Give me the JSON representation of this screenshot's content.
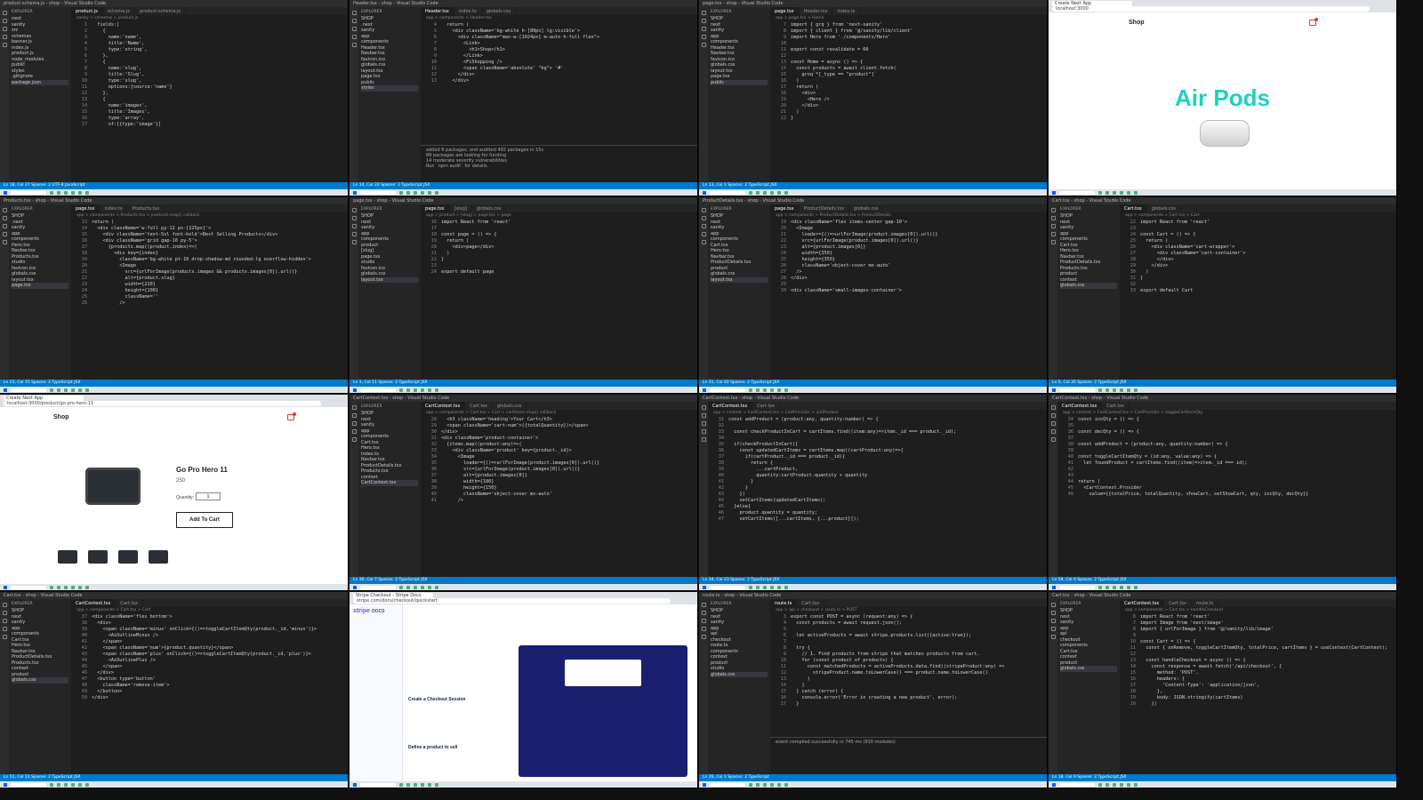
{
  "tiles": [
    {
      "kind": "editor",
      "title": "product-schema.js - shop - Visual Studio Code",
      "tabs": [
        "product.js",
        "schema.js",
        "product-schema.js"
      ],
      "breadcrumb": "sanity > schemas > product.js",
      "files": [
        "next",
        "sanity",
        "src",
        "schemas",
        "banner.js",
        "index.js",
        "product.js",
        "node_modules",
        "public",
        "styles",
        ".gitignore",
        "package.json"
      ],
      "code": [
        "  fields:[",
        "    {",
        "      name:'name',",
        "      title:'Name',",
        "      type:'string',",
        "    },",
        "    {",
        "      name:'slug',",
        "      title:'Slug',",
        "      type:'slug',",
        "      options:{source:'name'}",
        "    },",
        "    {",
        "      name:'images',",
        "      title:'Images',",
        "      type:'array',",
        "      of:[{type:'image'}]"
      ],
      "status": "Ln 18, Col 27  Spaces: 2  UTF-8  JavaScript"
    },
    {
      "kind": "editor",
      "title": "Header.tsx - shop - Visual Studio Code",
      "tabs": [
        "Header.tsx",
        "index.ts",
        "globals.css"
      ],
      "breadcrumb": "app > components > Header.tsx",
      "files": [
        "SHOP",
        ".next",
        "sanity",
        "app",
        "components",
        "Header.tsx",
        "Navbar.tsx",
        "favicon.ico",
        "globals.css",
        "layout.tsx",
        "page.tsx",
        "public",
        "styles"
      ],
      "code": [
        "  return (",
        "    <div className='bg-white h-[80px] lg:visible'>",
        "      <div className=\"max-w-[1024px] m-auto h-full flex\">",
        "        <Link>",
        "          <h1>Shop</h1>",
        "        </Link>",
        "        <FiShopping />",
        "        <span className='absolute' \"bg\"> '#'",
        "      </div>",
        "    </div>"
      ],
      "panel": [
        "added 8 packages, and audited 492 packages in 15s",
        "89 packages are looking for funding",
        "14 moderate severity vulnerabilities",
        "Run `npm audit` for details."
      ],
      "status": "Ln 14, Col 22  Spaces: 2  TypeScript JSX"
    },
    {
      "kind": "editor",
      "title": "page.tsx - shop - Visual Studio Code",
      "tabs": [
        "page.tsx",
        "Header.tsx",
        "index.ts"
      ],
      "breadcrumb": "app > page.tsx > Home",
      "files": [
        "SHOP",
        "next",
        "sanity",
        "app",
        "components",
        "Header.tsx",
        "Navbar.tsx",
        "favicon.ico",
        "globals.css",
        "layout.tsx",
        "page.tsx",
        "public"
      ],
      "code": [
        "import { grq } from 'next-sanity'",
        "import { client } from '@/sanity/lib/client'",
        "import Hero from './components/Hero'",
        "",
        "export const revalidate = 60",
        "",
        "const Home = async () => {",
        "  const products = await client.fetch(",
        "    groq`*[_type == \"product\"]`",
        "  )",
        "  return (",
        "    <div>",
        "      <Hero />",
        "    </div>",
        "  )",
        "}"
      ],
      "status": "Ln 13, Col 1  Spaces: 2  TypeScript JSX"
    },
    {
      "kind": "browser",
      "tab": "Create Next App",
      "url": "localhost:3000",
      "shop": "Shop",
      "headline": "Air Pods"
    },
    {
      "kind": "editor",
      "title": "Products.tsx - shop - Visual Studio Code",
      "tabs": [
        "page.tsx",
        "index.ts",
        "Products.tsx"
      ],
      "breadcrumb": "app > components > Products.tsx > products.map() callback",
      "files": [
        "SHOP",
        ".next",
        "sanity",
        "app",
        "components",
        "Hero.tsx",
        "Navbar.tsx",
        "Products.tsx",
        "studio",
        "favicon.ico",
        "globals.css",
        "layout.tsx",
        "page.tsx"
      ],
      "code": [
        "return (",
        "  <div className='w-full py-12 px-[125px]'>",
        "    <div className='text-5xl font-bold'>Best Selling Products</div>",
        "    <div className='grid gap-10 py-5'>",
        "      {products.map((product,index)=>(",
        "        <div key={index}",
        "          className='bg-white pt-10 drop-shadow-md rounded-lg overflow-hidden'>",
        "          <Image",
        "            src={urlForImage(products.images && products.images[0]).url()}",
        "            alt={product.slug}",
        "            width={220}",
        "            height={100}",
        "            className=''",
        "          />"
      ],
      "status": "Ln 23, Col 15  Spaces: 2  TypeScript JSX"
    },
    {
      "kind": "editor",
      "title": "page.tsx - shop - Visual Studio Code",
      "tabs": [
        "page.tsx",
        "[slug]",
        "globals.css"
      ],
      "breadcrumb": "app > product > [slug] > page.tsx > page",
      "files": [
        "SHOP",
        "next",
        "sanity",
        "app",
        "components",
        "product",
        "[slug]",
        "page.tsx",
        "studio",
        "favicon.ico",
        "globals.css",
        "layout.tsx"
      ],
      "code": [
        "import React from 'react'",
        "",
        "const page = () => {",
        "  return (",
        "    <div>page</div>",
        "  )",
        "}",
        "",
        "export default page"
      ],
      "status": "Ln 3, Col 11  Spaces: 2  TypeScript JSX"
    },
    {
      "kind": "editor",
      "title": "ProductDetails.tsx - shop - Visual Studio Code",
      "tabs": [
        "page.tsx",
        "ProductDetails.tsx",
        "globals.css"
      ],
      "breadcrumb": "app > components > ProductDetails.tsx > ProductDetails",
      "files": [
        "SHOP",
        "next",
        "sanity",
        "app",
        "components",
        "Cart.tsx",
        "Hero.tsx",
        "Navbar.tsx",
        "ProductDetails.tsx",
        "product",
        "globals.css",
        "layout.tsx"
      ],
      "code": [
        "<div className='flex items-center gap-10'>",
        "  <Image",
        "    loader={()=>urlForImage(product.images[0]).url()}",
        "    src={urlForImage(product.images[0]).url()}",
        "    alt={product.images[0]}",
        "    width={350}",
        "    height={350}",
        "    className='object-cover mx-auto'",
        "  />",
        "</div>",
        "",
        "<div className='small-images-container'>"
      ],
      "status": "Ln 31, Col 42  Spaces: 2  TypeScript JSX"
    },
    {
      "kind": "editor",
      "title": "Cart.tsx - shop - Visual Studio Code",
      "tabs": [
        "Cart.tsx",
        "globals.css"
      ],
      "breadcrumb": "app > components > Cart.tsx > Cart",
      "files": [
        "SHOP",
        "next",
        "sanity",
        "app",
        "components",
        "Cart.tsx",
        "Hero.tsx",
        "Navbar.tsx",
        "ProductDetails.tsx",
        "Products.tsx",
        "product",
        "context",
        "globals.css"
      ],
      "code": [
        "import React from 'react'",
        "",
        "const Cart = () => {",
        "  return (",
        "    <div className='cart-wrapper'>",
        "      <div className='cart-container'>",
        "      </div>",
        "    </div>",
        "  )",
        "}",
        "",
        "export default Cart"
      ],
      "status": "Ln 5, Col 35  Spaces: 2  TypeScript JSX"
    },
    {
      "kind": "product",
      "tab": "Create Next App",
      "url": "localhost:3000/product/go-pro-hero-11",
      "shop": "Shop",
      "name": "Go Pro Hero 11",
      "price": "250",
      "qty_label": "Quantity:",
      "qty": "1",
      "cta": "Add To Cart"
    },
    {
      "kind": "editor",
      "title": "CartContext.tsx - shop - Visual Studio Code",
      "tabs": [
        "CartContext.tsx",
        "Cart.tsx",
        "globals.css"
      ],
      "breadcrumb": "app > components > Cart.tsx > Cart > cartItems.map() callback",
      "files": [
        "SHOP",
        "next",
        "sanity",
        "app",
        "components",
        "Cart.tsx",
        "Hero.tsx",
        "index.ts",
        "Navbar.tsx",
        "ProductDetails.tsx",
        "Products.tsx",
        "context",
        "CartContext.tsx"
      ],
      "code": [
        "  <h3 className='heading'>Your Cart</h3>",
        "  <span className='cart-num'>({totalQuantity})</span>",
        "</div>",
        "<div className='product-container'>",
        "  {items.map((product:any)=>(",
        "    <div className='product' key={product._id}>",
        "      <Image",
        "        loader={()=>urlForImage(product.images[0]).url()}",
        "        src={urlForImage(product.images[0]).url()}",
        "        alt={product.images[0]}",
        "        width={180}",
        "        height={150}",
        "        className='object-cover mx-auto'",
        "      />"
      ],
      "status": "Ln 30, Col 7  Spaces: 2  TypeScript JSX"
    },
    {
      "kind": "editor",
      "title": "CartContext.tsx - shop - Visual Studio Code",
      "tabs": [
        "CartContext.tsx",
        "Cart.tsx"
      ],
      "breadcrumb": "app > context > CartContext.tsx > CartProvider > addProduct",
      "files": [],
      "code": [
        "const addProduct = (product:any, quantity:number) => {",
        "",
        "  const checkProductInCart = cartItems.find((item:any)=>item._id === product._id);",
        "",
        "  if(checkProductInCart){",
        "    const updatedCartItems = cartItems.map((cartProduct:any)=>{",
        "      if(cartProduct._id === product._id){",
        "        return {",
        "          ...cartProduct,",
        "          quantity:cartProduct.quantity + quantity",
        "        }",
        "      }",
        "    })",
        "    setCartItems(updatedCartItems);",
        "  }else{",
        "    product.quantity = quantity;",
        "    setCartItems([...cartItems, {...product}]);"
      ],
      "status": "Ln 34, Col 23  Spaces: 2  TypeScript JSX"
    },
    {
      "kind": "editor",
      "title": "CartContext.tsx - shop - Visual Studio Code",
      "tabs": [
        "CartContext.tsx",
        "Cart.tsx"
      ],
      "breadcrumb": "app > context > CartContext.tsx > CartProvider > toggleCartItemQty",
      "files": [],
      "code": [
        "const incQty = () => {",
        "",
        "const decQty = () => {",
        "",
        "const addProduct = (product:any, quantity:number) => {",
        "",
        "const toggleCartItemQty = (id:any, value:any) => {",
        "  let foundProduct = cartItems.find((item)=>item._id === id);",
        "",
        "",
        "return (",
        "  <CartContext.Provider",
        "    value={{totalPrice, totalQuantity, showCart, setShowCart, qty, incQty, decQty}}"
      ],
      "status": "Ln 58, Col 4  Spaces: 2  TypeScript JSX"
    },
    {
      "kind": "editor",
      "title": "Cart.tsx - shop - Visual Studio Code",
      "tabs": [
        "CartContext.tsx",
        "Cart.tsx"
      ],
      "breadcrumb": "app > components > Cart.tsx > Cart",
      "files": [
        "SHOP",
        "next",
        "sanity",
        "app",
        "components",
        "Cart.tsx",
        "Hero.tsx",
        "Navbar.tsx",
        "ProductDetails.tsx",
        "Products.tsx",
        "context",
        "product",
        "globals.css"
      ],
      "code": [
        "<div className='flex bottom'>",
        "  <div>",
        "    <span className='minus' onClick={()=>toggleCartItemQty(product._id,'minus')}>",
        "      <AiOutlineMinus />",
        "    </span>",
        "    <span className='num'>{product.quantity}</span>",
        "    <span className='plus' onClick={()=>toggleCartItemQty(product._id,'plus')}>",
        "      <AiOutlinePlus />",
        "    </span>",
        "  </div>",
        "  <button type='button'",
        "    className='remove-item'>",
        "  </button>",
        "</div>"
      ],
      "status": "Ln 51, Col 11  Spaces: 2  TypeScript JSX"
    },
    {
      "kind": "docs",
      "tab": "Stripe Checkout - Stripe Docs",
      "url": "stripe.com/docs/checkout/quickstart",
      "brand": "stripe",
      "brand2": "DOCS",
      "heading": "Create a Checkout Session",
      "sub": "Define a product to sell"
    },
    {
      "kind": "editor",
      "title": "route.ts - shop - Visual Studio Code",
      "tabs": [
        "route.ts",
        "Cart.tsx"
      ],
      "breadcrumb": "app > api > checkout > route.ts > POST",
      "files": [
        "SHOP",
        "next",
        "sanity",
        "app",
        "api",
        "checkout",
        "route.ts",
        "components",
        "context",
        "product",
        "studio",
        "globals.css"
      ],
      "code": [
        "export const POST = async (request:any) => {",
        "  const products = await request.json();",
        "",
        "  let activeProducts = await stripe.products.list({active:true});",
        "",
        "  try {",
        "    // 1. Find products from stripe that matches products from cart.",
        "    for (const product of products) {",
        "      const matchedProducts = activeProducts.data.find((stripeProduct:any) =>",
        "        stripeProduct.name.toLowerCase() === product.name.toLowerCase()",
        "      )",
        "    }",
        "  } catch (error) {",
        "    console.error('Error in creating a new product', error);",
        "  }"
      ],
      "panel": [
        "event compiled successfully in 745 ms (910 modules)"
      ],
      "status": "Ln 26, Col 1  Spaces: 2  TypeScript"
    },
    {
      "kind": "editor",
      "title": "Cart.tsx - shop - Visual Studio Code",
      "tabs": [
        "CartContext.tsx",
        "Cart.tsx",
        "route.ts"
      ],
      "breadcrumb": "app > components > Cart.tsx > handleCheckout",
      "files": [
        "SHOP",
        "next",
        "sanity",
        "app",
        "api",
        "checkout",
        "components",
        "Cart.tsx",
        "context",
        "product",
        "globals.css"
      ],
      "code": [
        "import React from 'react'",
        "import Image from 'next/image'",
        "import { urlForImage } from '@/sanity/lib/image'",
        "",
        "const Cart = () => {",
        "  const { onRemove, toggleCartItemQty, totalPrice, cartItems } = useContext(CartContext);",
        "",
        "  const handleCheckout = async () => {",
        "    const response = await fetch('/api/checkout', {",
        "      method: 'POST',",
        "      headers: {",
        "        'Content-Type': 'application/json',",
        "      },",
        "      body: JSON.stringify(cartItems)",
        "    })"
      ],
      "status": "Ln 18, Col 9  Spaces: 2  TypeScript JSX"
    }
  ]
}
